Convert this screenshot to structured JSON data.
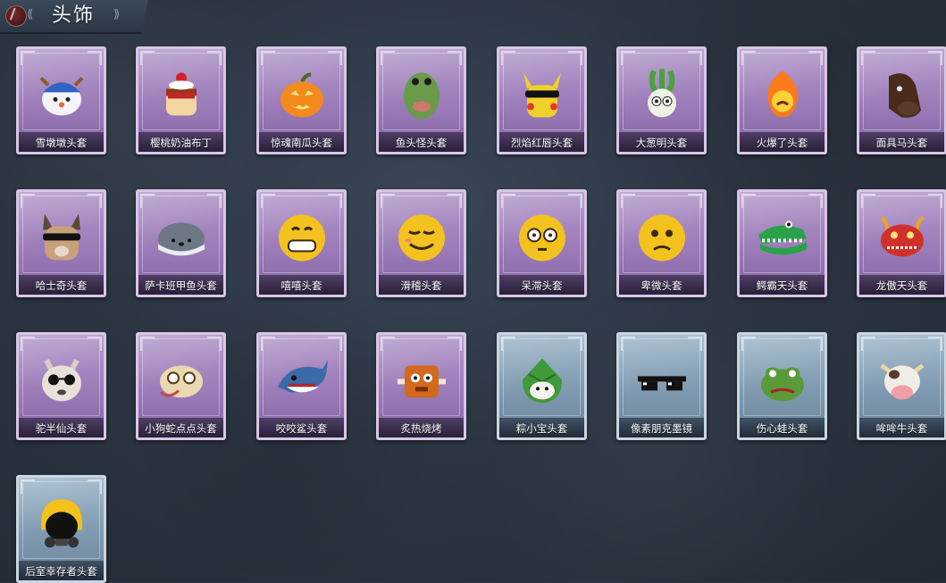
{
  "header": {
    "title": "头饰",
    "emblem_icon": "crest-emblem-icon",
    "left_deco_icon": "scroll-ornament-icon",
    "right_deco_icon": "scroll-ornament-icon"
  },
  "colors": {
    "purple_rarity": "#9b7bb8",
    "blue_rarity": "#7f9ab0",
    "background": "#2c3643"
  },
  "items": [
    {
      "label": "雪墩墩头套",
      "rarity": "purple",
      "icon": "snowman-reindeer-head-icon"
    },
    {
      "label": "樱桃奶油布丁",
      "rarity": "purple",
      "icon": "cherry-pudding-head-icon"
    },
    {
      "label": "惊魂南瓜头套",
      "rarity": "purple",
      "icon": "pumpkin-head-icon"
    },
    {
      "label": "鱼头怪头套",
      "rarity": "purple",
      "icon": "fish-head-icon"
    },
    {
      "label": "烈焰红唇头套",
      "rarity": "purple",
      "icon": "yellow-mouse-sunglasses-head-icon"
    },
    {
      "label": "大葱明头套",
      "rarity": "purple",
      "icon": "scallion-head-icon"
    },
    {
      "label": "火爆了头套",
      "rarity": "purple",
      "icon": "fireball-head-icon"
    },
    {
      "label": "面具马头套",
      "rarity": "purple",
      "icon": "horse-mask-head-icon"
    },
    {
      "label": "哈士奇头套",
      "rarity": "purple",
      "icon": "husky-sunglasses-head-icon"
    },
    {
      "label": "萨卡班甲鱼头套",
      "rarity": "purple",
      "icon": "sacabambaspis-head-icon"
    },
    {
      "label": "嘻嘻头套",
      "rarity": "purple",
      "icon": "grin-emoji-head-icon"
    },
    {
      "label": "滑稽头套",
      "rarity": "purple",
      "icon": "sly-emoji-head-icon"
    },
    {
      "label": "呆滞头套",
      "rarity": "purple",
      "icon": "dazed-emoji-head-icon"
    },
    {
      "label": "卑微头套",
      "rarity": "purple",
      "icon": "humble-emoji-head-icon"
    },
    {
      "label": "鳄霸天头套",
      "rarity": "purple",
      "icon": "crocodile-head-icon"
    },
    {
      "label": "龙傲天头套",
      "rarity": "purple",
      "icon": "dragon-head-icon"
    },
    {
      "label": "驼半仙头套",
      "rarity": "purple",
      "icon": "alpaca-sunglasses-head-icon"
    },
    {
      "label": "小狗蛇点点头套",
      "rarity": "purple",
      "icon": "dog-snake-head-icon"
    },
    {
      "label": "咬咬鲨头套",
      "rarity": "purple",
      "icon": "shark-head-icon"
    },
    {
      "label": "炙热烧烤",
      "rarity": "purple",
      "icon": "roast-meat-head-icon"
    },
    {
      "label": "粽小宝头套",
      "rarity": "blue",
      "icon": "zongzi-head-icon"
    },
    {
      "label": "像素朋克墨镜",
      "rarity": "blue",
      "icon": "pixel-sunglasses-icon"
    },
    {
      "label": "伤心蛙头套",
      "rarity": "blue",
      "icon": "sad-frog-head-icon"
    },
    {
      "label": "哞哞牛头套",
      "rarity": "blue",
      "icon": "cow-head-icon"
    },
    {
      "label": "后室幸存者头套",
      "rarity": "blue",
      "icon": "gas-mask-helmet-icon"
    }
  ]
}
